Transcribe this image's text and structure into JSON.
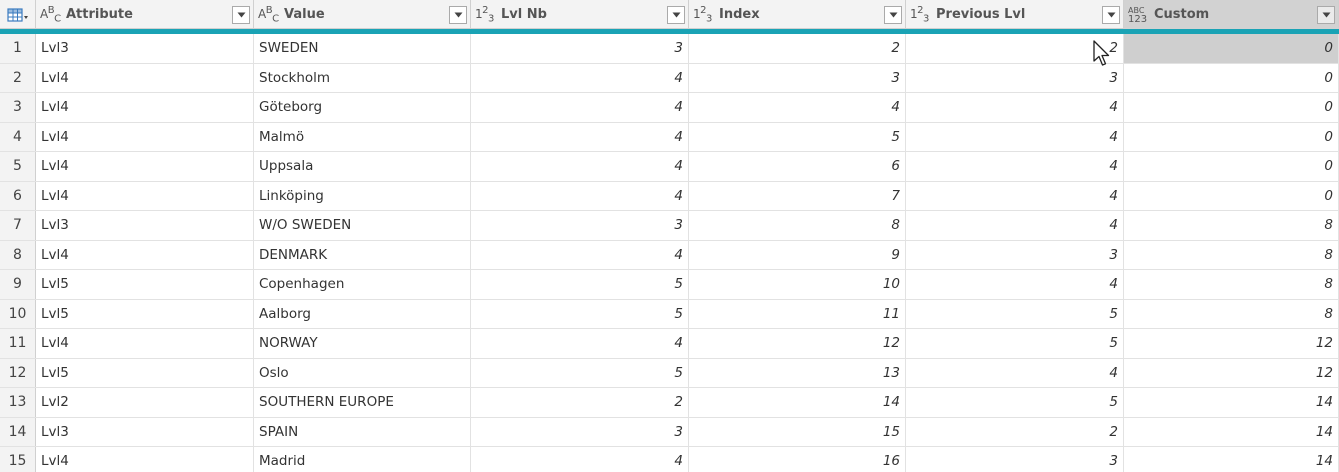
{
  "columns": [
    {
      "name": "Attribute",
      "type": "text",
      "type_glyph": "ABC"
    },
    {
      "name": "Value",
      "type": "text",
      "type_glyph": "ABC"
    },
    {
      "name": "Lvl Nb",
      "type": "whole-number",
      "type_glyph": "123"
    },
    {
      "name": "Index",
      "type": "whole-number",
      "type_glyph": "123"
    },
    {
      "name": "Previous Lvl",
      "type": "whole-number",
      "type_glyph": "123"
    },
    {
      "name": "Custom",
      "type": "any",
      "type_glyph": "ABC 123"
    }
  ],
  "rows": [
    {
      "n": "1",
      "attribute": "Lvl3",
      "value": "SWEDEN",
      "lvl_nb": "3",
      "index": "2",
      "previous_lvl": "2",
      "custom": "0"
    },
    {
      "n": "2",
      "attribute": "Lvl4",
      "value": "Stockholm",
      "lvl_nb": "4",
      "index": "3",
      "previous_lvl": "3",
      "custom": "0"
    },
    {
      "n": "3",
      "attribute": "Lvl4",
      "value": "Göteborg",
      "lvl_nb": "4",
      "index": "4",
      "previous_lvl": "4",
      "custom": "0"
    },
    {
      "n": "4",
      "attribute": "Lvl4",
      "value": "Malmö",
      "lvl_nb": "4",
      "index": "5",
      "previous_lvl": "4",
      "custom": "0"
    },
    {
      "n": "5",
      "attribute": "Lvl4",
      "value": "Uppsala",
      "lvl_nb": "4",
      "index": "6",
      "previous_lvl": "4",
      "custom": "0"
    },
    {
      "n": "6",
      "attribute": "Lvl4",
      "value": "Linköping",
      "lvl_nb": "4",
      "index": "7",
      "previous_lvl": "4",
      "custom": "0"
    },
    {
      "n": "7",
      "attribute": "Lvl3",
      "value": "W/O SWEDEN",
      "lvl_nb": "3",
      "index": "8",
      "previous_lvl": "4",
      "custom": "8"
    },
    {
      "n": "8",
      "attribute": "Lvl4",
      "value": "DENMARK",
      "lvl_nb": "4",
      "index": "9",
      "previous_lvl": "3",
      "custom": "8"
    },
    {
      "n": "9",
      "attribute": "Lvl5",
      "value": "Copenhagen",
      "lvl_nb": "5",
      "index": "10",
      "previous_lvl": "4",
      "custom": "8"
    },
    {
      "n": "10",
      "attribute": "Lvl5",
      "value": "Aalborg",
      "lvl_nb": "5",
      "index": "11",
      "previous_lvl": "5",
      "custom": "8"
    },
    {
      "n": "11",
      "attribute": "Lvl4",
      "value": "NORWAY",
      "lvl_nb": "4",
      "index": "12",
      "previous_lvl": "5",
      "custom": "12"
    },
    {
      "n": "12",
      "attribute": "Lvl5",
      "value": "Oslo",
      "lvl_nb": "5",
      "index": "13",
      "previous_lvl": "4",
      "custom": "12"
    },
    {
      "n": "13",
      "attribute": "Lvl2",
      "value": "SOUTHERN EUROPE",
      "lvl_nb": "2",
      "index": "14",
      "previous_lvl": "5",
      "custom": "14"
    },
    {
      "n": "14",
      "attribute": "Lvl3",
      "value": "SPAIN",
      "lvl_nb": "3",
      "index": "15",
      "previous_lvl": "2",
      "custom": "14"
    },
    {
      "n": "15",
      "attribute": "Lvl4",
      "value": "Madrid",
      "lvl_nb": "4",
      "index": "16",
      "previous_lvl": "3",
      "custom": "14"
    }
  ],
  "selected_column": "Custom",
  "selected_cell": {
    "row": 1,
    "column": "Custom"
  },
  "icons": {
    "table_menu": "table-grid-icon",
    "text_type": "abc-type-icon",
    "number_type": "123-type-icon",
    "any_type": "abc-123-type-icon",
    "filter_dropdown": "chevron-down-icon",
    "cursor": "mouse-pointer-icon"
  },
  "colors": {
    "accent_bar": "#1aa3b5",
    "header_bg": "#f3f3f3",
    "selected_bg": "#cfcfcf",
    "grid_line": "#e2e2e2"
  }
}
